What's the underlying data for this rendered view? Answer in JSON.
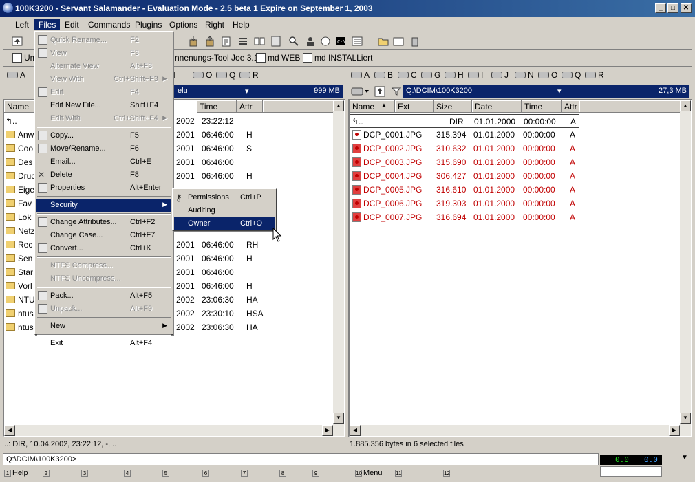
{
  "window": {
    "title": "100K3200 - Servant Salamander - Evaluation Mode - 2.5 beta 1 Expire on September 1, 2003",
    "min": "_",
    "max": "□",
    "close": "✕"
  },
  "menubar": [
    "Left",
    "Files",
    "Edit",
    "Commands",
    "Plugins",
    "Options",
    "Right",
    "Help"
  ],
  "hotpaths": [
    "Um",
    "nnenungs-Tool Joe 3.1",
    "md WEB",
    "md INSTALLiert"
  ],
  "left_panel": {
    "drives": [
      "A",
      "N",
      "O",
      "Q",
      "R"
    ],
    "path_fragment": "elu",
    "free": "999 MB",
    "columns": [
      "Name",
      "Time",
      "Attr"
    ],
    "rows": [
      {
        "name": "",
        "date": "2002",
        "time": "23:22:12",
        "attr": ""
      },
      {
        "name": "Anw",
        "date": "2001",
        "time": "06:46:00",
        "attr": "H"
      },
      {
        "name": "Coo",
        "date": "2001",
        "time": "06:46:00",
        "attr": "S"
      },
      {
        "name": "Des",
        "date": "2001",
        "time": "06:46:00",
        "attr": ""
      },
      {
        "name": "Druc",
        "date": "2001",
        "time": "06:46:00",
        "attr": "H"
      },
      {
        "name": "Eige",
        "date": "",
        "time": "",
        "attr": ""
      },
      {
        "name": "Fav",
        "date": "",
        "time": "",
        "attr": ""
      },
      {
        "name": "Lok",
        "date": "",
        "time": "",
        "attr": ""
      },
      {
        "name": "Netz",
        "date": "",
        "time": "",
        "attr": ""
      },
      {
        "name": "Rec",
        "date": "2001",
        "time": "06:46:00",
        "attr": "RH"
      },
      {
        "name": "Sen",
        "date": "2001",
        "time": "06:46:00",
        "attr": "H"
      },
      {
        "name": "Star",
        "date": "2001",
        "time": "06:46:00",
        "attr": ""
      },
      {
        "name": "Vorl",
        "date": "2001",
        "time": "06:46:00",
        "attr": "H"
      },
      {
        "name": "NTU",
        "date": "2002",
        "time": "23:06:30",
        "attr": "HA"
      },
      {
        "name": "ntus",
        "date": "2002",
        "time": "23:30:10",
        "attr": "HSA"
      },
      {
        "name": "ntus",
        "date": "2002",
        "time": "23:06:30",
        "attr": "HA"
      }
    ],
    "status": "..: DIR, 10.04.2002, 23:22:12, -, .."
  },
  "right_panel": {
    "drives": [
      "A",
      "B",
      "C",
      "G",
      "H",
      "I",
      "J",
      "N",
      "O",
      "Q",
      "R"
    ],
    "path": "Q:\\DCIM\\100K3200",
    "free": "27,3 MB",
    "columns": [
      "Name",
      "Ext",
      "Size",
      "Date",
      "Time",
      "Attr"
    ],
    "updir": {
      "size": "DIR",
      "date": "01.01.2000",
      "time": "00:00:00",
      "attr": "A"
    },
    "rows": [
      {
        "name": "DCP_0001.JPG",
        "size": "315.394",
        "date": "01.01.2000",
        "time": "00:00:00",
        "attr": "A",
        "selected": false
      },
      {
        "name": "DCP_0002.JPG",
        "size": "310.632",
        "date": "01.01.2000",
        "time": "00:00:00",
        "attr": "A",
        "selected": true
      },
      {
        "name": "DCP_0003.JPG",
        "size": "315.690",
        "date": "01.01.2000",
        "time": "00:00:00",
        "attr": "A",
        "selected": true
      },
      {
        "name": "DCP_0004.JPG",
        "size": "306.427",
        "date": "01.01.2000",
        "time": "00:00:00",
        "attr": "A",
        "selected": true
      },
      {
        "name": "DCP_0005.JPG",
        "size": "316.610",
        "date": "01.01.2000",
        "time": "00:00:00",
        "attr": "A",
        "selected": true
      },
      {
        "name": "DCP_0006.JPG",
        "size": "319.303",
        "date": "01.01.2000",
        "time": "00:00:00",
        "attr": "A",
        "selected": true
      },
      {
        "name": "DCP_0007.JPG",
        "size": "316.694",
        "date": "01.01.2000",
        "time": "00:00:00",
        "attr": "A",
        "selected": true
      }
    ],
    "status": "1.885.356 bytes in 6 selected files"
  },
  "files_menu": [
    {
      "label": "Quick Rename...",
      "shortcut": "F2",
      "disabled": true
    },
    {
      "label": "View",
      "shortcut": "F3",
      "disabled": true
    },
    {
      "label": "Alternate View",
      "shortcut": "Alt+F3",
      "disabled": true
    },
    {
      "label": "View With",
      "shortcut": "Ctrl+Shift+F3",
      "disabled": true,
      "submenu": true
    },
    {
      "label": "Edit",
      "shortcut": "F4",
      "disabled": true
    },
    {
      "label": "Edit New File...",
      "shortcut": "Shift+F4",
      "disabled": false
    },
    {
      "label": "Edit With",
      "shortcut": "Ctrl+Shift+F4",
      "disabled": true,
      "submenu": true
    },
    {
      "label": "Copy...",
      "shortcut": "F5",
      "disabled": false
    },
    {
      "label": "Move/Rename...",
      "shortcut": "F6",
      "disabled": false
    },
    {
      "label": "Email...",
      "shortcut": "Ctrl+E",
      "disabled": false
    },
    {
      "label": "Delete",
      "shortcut": "F8",
      "disabled": false
    },
    {
      "label": "Properties",
      "shortcut": "Alt+Enter",
      "disabled": false
    },
    {
      "label": "Security",
      "shortcut": "",
      "disabled": false,
      "submenu": true,
      "selected": true
    },
    {
      "label": "Change Attributes...",
      "shortcut": "Ctrl+F2",
      "disabled": false
    },
    {
      "label": "Change Case...",
      "shortcut": "Ctrl+F7",
      "disabled": false
    },
    {
      "label": "Convert...",
      "shortcut": "Ctrl+K",
      "disabled": false
    },
    {
      "label": "NTFS Compress...",
      "shortcut": "",
      "disabled": true
    },
    {
      "label": "NTFS Uncompress...",
      "shortcut": "",
      "disabled": true
    },
    {
      "label": "Pack...",
      "shortcut": "Alt+F5",
      "disabled": false
    },
    {
      "label": "Unpack...",
      "shortcut": "Alt+F9",
      "disabled": true
    },
    {
      "label": "New",
      "shortcut": "",
      "disabled": false,
      "submenu": true
    },
    {
      "label": "Exit",
      "shortcut": "Alt+F4",
      "disabled": false
    }
  ],
  "security_menu": [
    {
      "label": "Permissions",
      "shortcut": "Ctrl+P"
    },
    {
      "label": "Auditing",
      "shortcut": ""
    },
    {
      "label": "Owner",
      "shortcut": "Ctrl+O",
      "selected": true
    }
  ],
  "command_line": "Q:\\DCIM\\100K3200>",
  "fkeys": [
    {
      "num": "1",
      "label": "Help"
    },
    {
      "num": "2",
      "label": ""
    },
    {
      "num": "3",
      "label": ""
    },
    {
      "num": "4",
      "label": ""
    },
    {
      "num": "5",
      "label": ""
    },
    {
      "num": "6",
      "label": ""
    },
    {
      "num": "7",
      "label": ""
    },
    {
      "num": "8",
      "label": ""
    },
    {
      "num": "9",
      "label": ""
    },
    {
      "num": "10",
      "label": "Menu"
    },
    {
      "num": "11",
      "label": ""
    },
    {
      "num": "12",
      "label": ""
    }
  ],
  "indicator": {
    "left": "0.0",
    "right": "0.0"
  }
}
